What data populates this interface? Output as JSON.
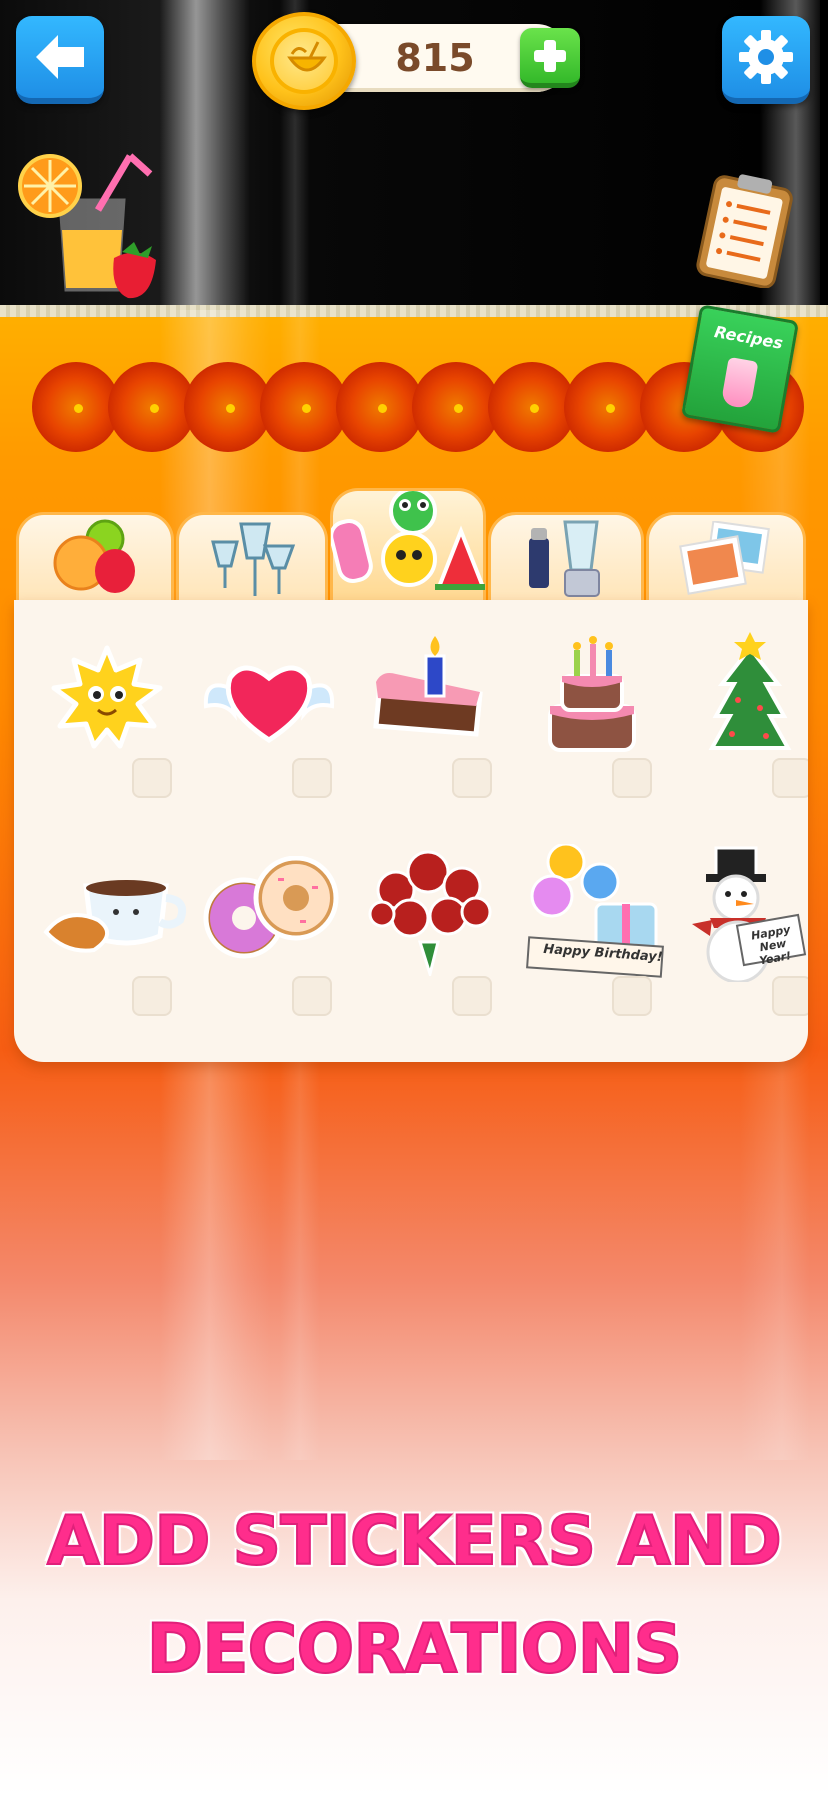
{
  "header": {
    "coins": "815",
    "back_icon": "back-arrow-icon",
    "settings_icon": "gear-icon",
    "coin_icon": "coconut-coin-icon",
    "plus_icon": "plus-icon"
  },
  "recipes": {
    "label": "Recipes"
  },
  "tabs": [
    {
      "name": "fruits",
      "icon": "fruits-icon",
      "active": false
    },
    {
      "name": "glasses",
      "icon": "glasses-icon",
      "active": false
    },
    {
      "name": "stickers",
      "icon": "stickers-icon",
      "active": true
    },
    {
      "name": "appliances",
      "icon": "blender-icon",
      "active": false
    },
    {
      "name": "photos",
      "icon": "photos-icon",
      "active": false
    }
  ],
  "stickers": {
    "row1": [
      "sun-sticker",
      "winged-heart-sticker",
      "cake-slice-sticker",
      "birthday-cake-sticker",
      "christmas-tree-sticker"
    ],
    "row2": [
      "coffee-croissant-sticker",
      "donuts-sticker",
      "roses-bouquet-sticker",
      "happy-birthday-sticker",
      "snowman-sticker"
    ],
    "birthday_banner": "Happy Birthday!",
    "new_year_banner_line1": "Happy",
    "new_year_banner_line2": "New Year!"
  },
  "caption": {
    "line1": "ADD STICKERS AND",
    "line2": "DECORATIONS"
  },
  "colors": {
    "caption": "#ff2d8c",
    "blue_button": "#1f8fe6",
    "green_button": "#34b92a",
    "panel": "#fcf5ec"
  }
}
